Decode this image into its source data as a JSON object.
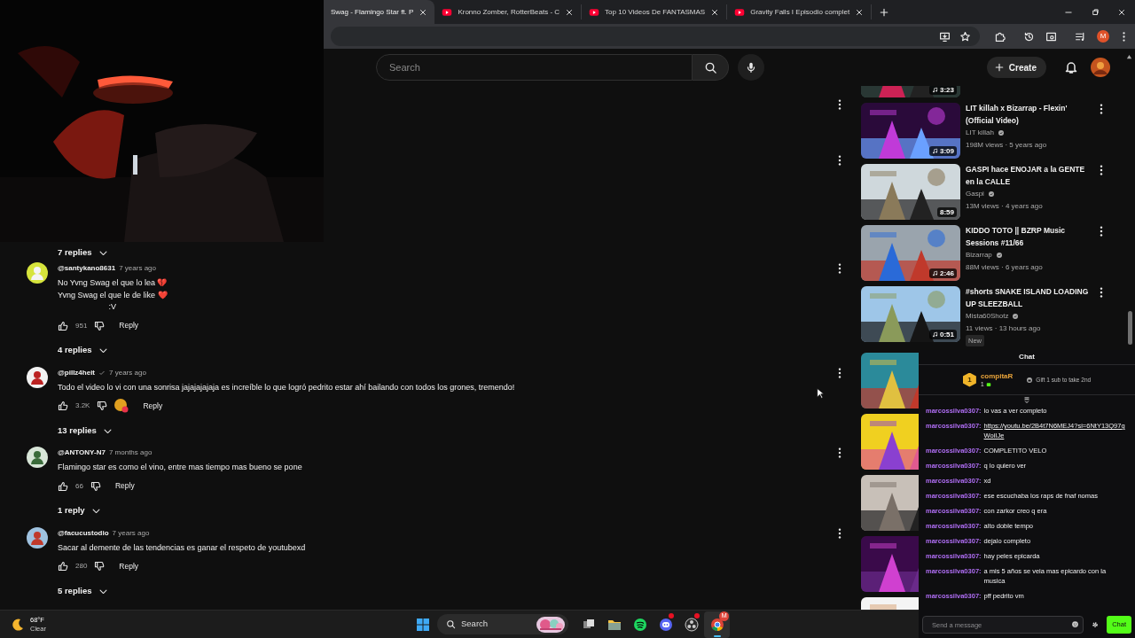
{
  "browser": {
    "tabs": [
      {
        "title": "Swag - Flamingo Star ft. P",
        "selected": true
      },
      {
        "title": "Kronno Zomber, RotterBeats - C",
        "selected": false
      },
      {
        "title": "Top 10 Videos De FANTASMAS",
        "selected": false
      },
      {
        "title": "Gravity Falls I Episodio complet",
        "selected": false
      }
    ],
    "profile_initial": "M"
  },
  "header": {
    "search": {
      "placeholder": "Search"
    },
    "create_label": "Create"
  },
  "comments": {
    "top_replies": "7 replies",
    "items": [
      {
        "author": "@santykano8631",
        "verified": false,
        "time": "7 years ago",
        "text": "No Yvng Swag el que lo lea 💔\nYvng Swag el que le de like ❤️\n                       :V",
        "likes": "951",
        "hearted": false,
        "reply": "Reply",
        "replies": "4 replies"
      },
      {
        "author": "@pillz4heit",
        "verified": true,
        "time": "7 years ago",
        "text": "Todo el video lo vi con una sonrisa jajajajajaja es increíble lo que logró pedrito estar ahí bailando con todos los grones, tremendo!",
        "likes": "3.2K",
        "hearted": true,
        "reply": "Reply",
        "replies": "13 replies"
      },
      {
        "author": "@ANTONY-N7",
        "verified": false,
        "time": "7 months ago",
        "text": "Flamingo star es como el vino, entre mas tiempo mas bueno se pone",
        "likes": "66",
        "hearted": false,
        "reply": "Reply",
        "replies": "1 reply"
      },
      {
        "author": "@facucustodio",
        "verified": false,
        "time": "7 years ago",
        "text": "Sacar al demente de las tendencias es ganar el respeto de youtubexd",
        "likes": "280",
        "hearted": false,
        "reply": "Reply",
        "replies": "5 replies"
      }
    ]
  },
  "sidebar": {
    "videos": [
      {
        "kind": "partial",
        "duration": "3:23",
        "music": true
      },
      {
        "kind": "full",
        "title": "LIT killah x Bizarrap - Flexin' (Official Video)",
        "channel": "LIT killah",
        "verified": true,
        "meta": "198M views · 5 years ago",
        "duration": "3:09",
        "music": true
      },
      {
        "kind": "full",
        "title": "GASPI hace ENOJAR a la GENTE en la CALLE",
        "channel": "Gaspi",
        "verified": true,
        "meta": "13M views · 4 years ago",
        "duration": "8:59",
        "music": false
      },
      {
        "kind": "full",
        "title": "KIDDO TOTO || BZRP Music Sessions #11/66",
        "channel": "Bizarrap",
        "verified": true,
        "meta": "88M views · 6 years ago",
        "duration": "2:46",
        "music": true
      },
      {
        "kind": "full",
        "title": "#shorts SNAKE ISLAND LOADING UP SLEEZBALL",
        "channel": "Mista60Shotz",
        "verified": true,
        "meta": "11 views · 13 hours ago",
        "duration": "0:51",
        "music": true,
        "badge": "New"
      },
      {
        "kind": "covered"
      },
      {
        "kind": "covered"
      },
      {
        "kind": "covered"
      },
      {
        "kind": "covered"
      },
      {
        "kind": "covered"
      }
    ]
  },
  "chat": {
    "title": "Chat",
    "leader": {
      "rank": "1",
      "name": "compitaR",
      "count": "1"
    },
    "gift_text": "Gift 1 sub to take 2nd",
    "messages": [
      {
        "user": "marcossilva0307:",
        "kind": "text",
        "text": "lo vas a ver completo"
      },
      {
        "user": "marcossilva0307:",
        "kind": "link",
        "text": "https://youtu.be/2B4t7N6MEJ4?si=6NtY13Q97gWoiIJe"
      },
      {
        "user": "marcossilva0307:",
        "kind": "text",
        "text": "COMPLETITO VELO"
      },
      {
        "user": "marcossilva0307:",
        "kind": "text",
        "text": "q lo quiero ver"
      },
      {
        "user": "marcossilva0307:",
        "kind": "text",
        "text": "xd"
      },
      {
        "user": "marcossilva0307:",
        "kind": "text",
        "text": "ese escuchaba los raps de fnaf nomas"
      },
      {
        "user": "marcossilva0307:",
        "kind": "text",
        "text": "con zarkor creo q era"
      },
      {
        "user": "marcossilva0307:",
        "kind": "text",
        "text": "alto doble tempo"
      },
      {
        "user": "marcossilva0307:",
        "kind": "text",
        "text": "dejalo completo"
      },
      {
        "user": "marcossilva0307:",
        "kind": "text",
        "text": "hay peles epicarda"
      },
      {
        "user": "marcossilva0307:",
        "kind": "text",
        "text": "a mis 5 años se veia mas epicardo con la musica"
      },
      {
        "user": "marcossilva0307:",
        "kind": "text",
        "text": "pff pedrito vm"
      }
    ],
    "input": {
      "placeholder": "Send a message"
    },
    "send_label": "Chat"
  },
  "taskbar": {
    "weather": {
      "temp": "68°F",
      "condition": "Clear"
    },
    "search_label": "Search",
    "apps": [
      {
        "kind": "task-view",
        "active": false,
        "alert": false
      },
      {
        "kind": "folder",
        "active": false,
        "alert": false
      },
      {
        "kind": "spotify",
        "active": false,
        "alert": false
      },
      {
        "kind": "discord",
        "active": false,
        "alert": true
      },
      {
        "kind": "obs",
        "active": false,
        "alert": true
      },
      {
        "kind": "chrome",
        "active": true,
        "alert": false,
        "badge": "M"
      }
    ]
  }
}
